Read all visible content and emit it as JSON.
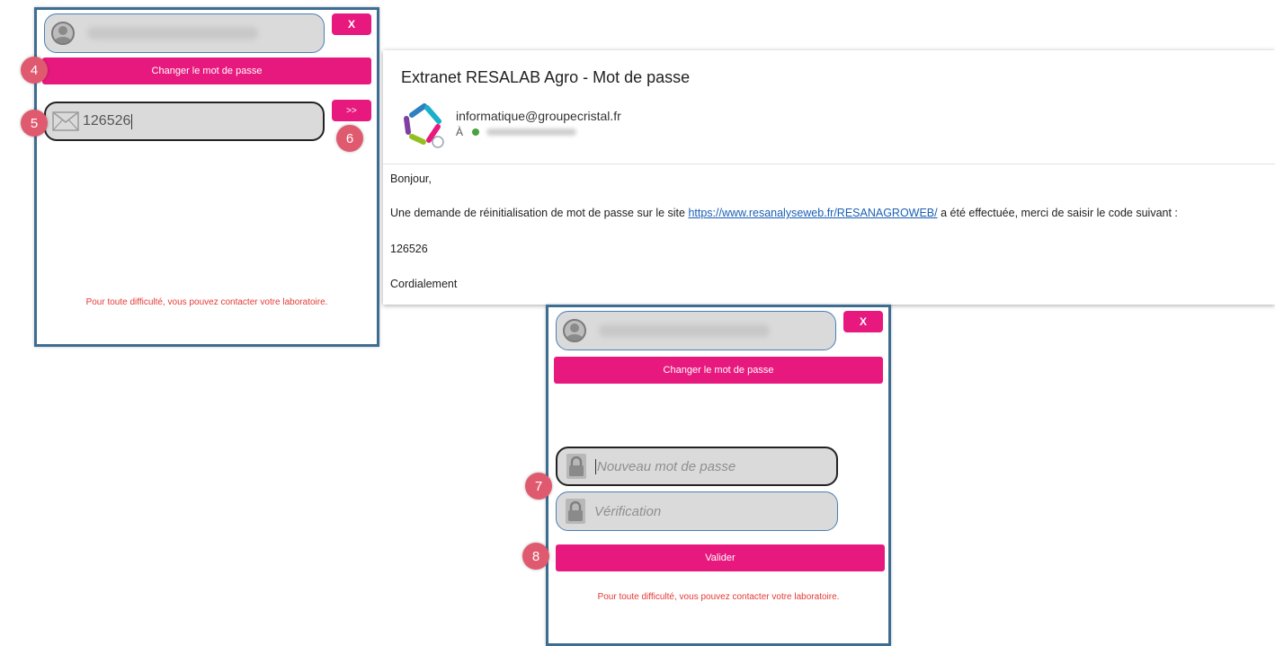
{
  "panel_step1": {
    "close_label": "X",
    "change_password_label": "Changer le mot de passe",
    "code_value": "126526",
    "next_label": ">>",
    "footer_note": "Pour toute difficulté, vous pouvez contacter votre laboratoire."
  },
  "email": {
    "subject": "Extranet RESALAB Agro - Mot de passe",
    "sender": "informatique@groupecristal.fr",
    "to_label": "À",
    "greeting": "Bonjour,",
    "line_before_link": "Une demande de réinitialisation de mot de passe sur le site",
    "link": "https://www.resanalyseweb.fr/RESANAGROWEB/",
    "line_after_link": "a été effectuée, merci de saisir le code suivant :",
    "code": "126526",
    "closing": "Cordialement"
  },
  "panel_step2": {
    "close_label": "X",
    "change_password_label": "Changer le mot de passe",
    "new_password_placeholder": "Nouveau mot de passe",
    "verification_placeholder": "Vérification",
    "validate_label": "Valider",
    "footer_note": "Pour toute difficulté, vous pouvez contacter votre laboratoire."
  },
  "step_badges": [
    "4",
    "5",
    "6",
    "7",
    "8"
  ],
  "colors": {
    "accent_pink": "#e8197e",
    "badge": "#e05a6f",
    "panel_border": "#3e6d92",
    "footer_red": "#e53935",
    "link_blue": "#1a5fb4"
  }
}
